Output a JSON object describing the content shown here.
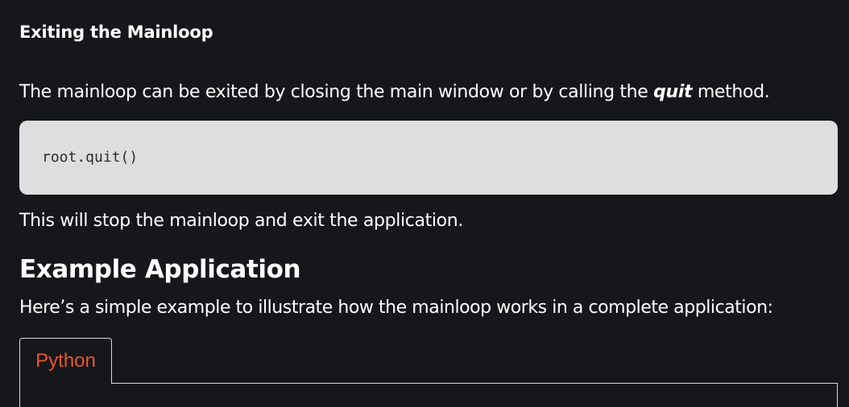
{
  "section": {
    "heading": "Exiting the Mainloop",
    "para1_before": "The mainloop can be exited by closing the main window or by calling the ",
    "para1_emphasis": "quit",
    "para1_after": " method.",
    "code": "root.quit()",
    "para2": "This will stop the mainloop and exit the application."
  },
  "example": {
    "heading": "Example Application",
    "intro": "Here’s a simple example to illustrate how the mainloop works in a complete application:",
    "tabs": [
      {
        "label": "Python",
        "active": true
      }
    ]
  },
  "colors": {
    "background": "#16171b",
    "text": "#ffffff",
    "code_background": "#dedede",
    "active_tab_text": "#e8552f",
    "tab_border": "#d9d9d9"
  }
}
